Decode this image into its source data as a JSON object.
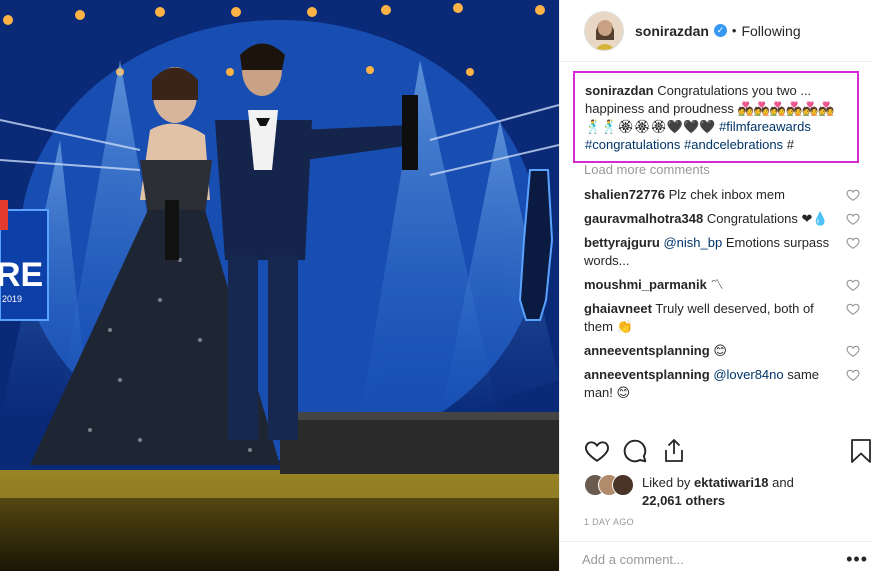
{
  "post": {
    "username": "sonirazdan",
    "verified": true,
    "follow_status": "Following",
    "dot": "•",
    "caption": {
      "username": "sonirazdan",
      "line1": "Congratulations you two ...",
      "line2": "happiness and proudness 💑💑💑💑💑💑",
      "line3_emoji": "🕺🕺🏵🏵🏵🖤🖤🖤",
      "hashtags": [
        "#filmfareawards",
        "#congratulations",
        "#andcelebrations",
        "#"
      ]
    },
    "load_more": "Load more comments",
    "comments": [
      {
        "user": "shalien72776",
        "text": "Plz chek inbox mem"
      },
      {
        "user": "gauravmalhotra348",
        "text": "Congratulations ❤💧"
      },
      {
        "user": "bettyrajguru",
        "mention": "@nish_bp",
        "text": "Emotions surpass words..."
      },
      {
        "user": "moushmi_parmanik",
        "text": "〽"
      },
      {
        "user": "ghaiavneet",
        "text": "Truly well deserved, both of them 👏"
      },
      {
        "user": "anneeventsplanning",
        "text": "😊"
      },
      {
        "user": "anneeventsplanning",
        "mention": "@lover84no",
        "text": "same man! 😊"
      }
    ],
    "actions": {
      "like": "heart-outline-icon",
      "comment": "comment-bubble-icon",
      "share": "share-icon",
      "save": "bookmark-icon"
    },
    "liked_by": {
      "prefix": "Liked by",
      "user": "ektatiwari18",
      "and": "and",
      "others": "22,061 others"
    },
    "timestamp": "1 DAY AGO",
    "add_comment_placeholder": "Add a comment...",
    "more_options": "•••"
  },
  "colors": {
    "highlight_border": "#d62ad8",
    "link": "#003569",
    "verified": "#3897f0"
  }
}
